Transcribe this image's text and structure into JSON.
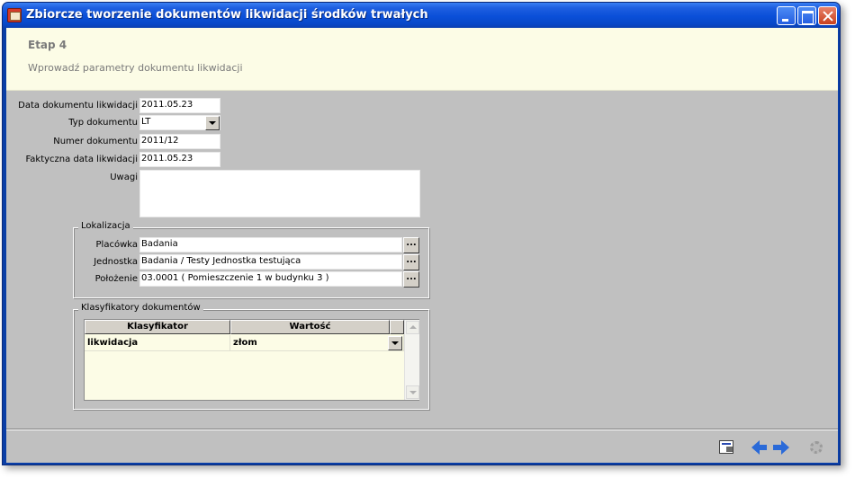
{
  "window": {
    "title": "Zbiorcze tworzenie dokumentów likwidacji środków trwałych"
  },
  "header": {
    "step": "Etap 4",
    "description": "Wprowadź parametry dokumentu likwidacji"
  },
  "form": {
    "data_label": "Data dokumentu likwidacji",
    "data_value": "2011.05.23",
    "typ_label": "Typ dokumentu",
    "typ_value": "LT",
    "numer_label": "Numer dokumentu",
    "numer_value": "2011/12",
    "faktyczna_label": "Faktyczna data likwidacji",
    "faktyczna_value": "2011.05.23",
    "uwagi_label": "Uwagi",
    "uwagi_value": ""
  },
  "lokalizacja": {
    "legend": "Lokalizacja",
    "placowka_label": "Placówka",
    "placowka_value": "Badania",
    "jednostka_label": "Jednostka",
    "jednostka_value": "Badania / Testy Jednostka testująca",
    "polozenie_label": "Położenie",
    "polozenie_value": "03.0001 ( Pomieszczenie 1 w budynku 3 )",
    "browse_label": "..."
  },
  "klasyfikatory": {
    "legend": "Klasyfikatory dokumentów",
    "columns": [
      "Klasyfikator",
      "Wartość"
    ],
    "rows": [
      {
        "klasyfikator": "likwidacja",
        "wartosc": "złom"
      }
    ]
  },
  "icons": {
    "app": "app-icon",
    "minimize": "minimize-icon",
    "maximize": "maximize-icon",
    "close": "close-icon",
    "report": "document-report-icon",
    "back": "arrow-left-icon",
    "next": "arrow-right-icon",
    "finish": "gear-icon"
  },
  "colors": {
    "titlebar": "#0a4fd8",
    "header_bg": "#fcfce6",
    "client_bg": "#c0c0c0",
    "nav_arrow": "#2a6ad8"
  }
}
